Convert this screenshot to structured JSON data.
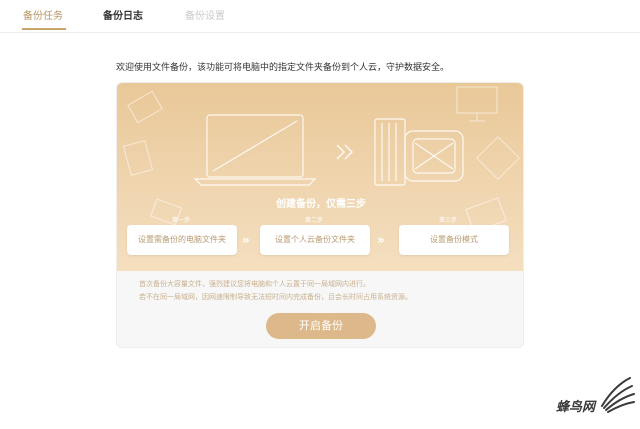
{
  "tabs": [
    {
      "label": "备份任务",
      "state": "active"
    },
    {
      "label": "备份日志",
      "state": "normal"
    },
    {
      "label": "备份设置",
      "state": "disabled"
    }
  ],
  "intro_text": "欢迎使用文件备份，该功能可将电脑中的指定文件夹备份到个人云，守护数据安全。",
  "hero": {
    "title": "创建备份，仅需三步",
    "steps": [
      {
        "label": "第一步",
        "button": "设置需备份的电脑文件夹"
      },
      {
        "label": "第二步",
        "button": "设置个人云备份文件夹"
      },
      {
        "label": "第三步",
        "button": "设置备份模式"
      }
    ]
  },
  "notes": [
    "首次备份大容量文件，强烈建议您将电脑和个人云置于同一局域网内进行。",
    "若不在同一局域网，因网速限制导致无法短时间内完成备份，且会长时间占用系统资源。"
  ],
  "start_button": "开启备份",
  "watermark": "蜂鸟网",
  "colors": {
    "accent": "#c9a46b",
    "hero_top": "#e9c898",
    "button": "#dcb88a"
  }
}
